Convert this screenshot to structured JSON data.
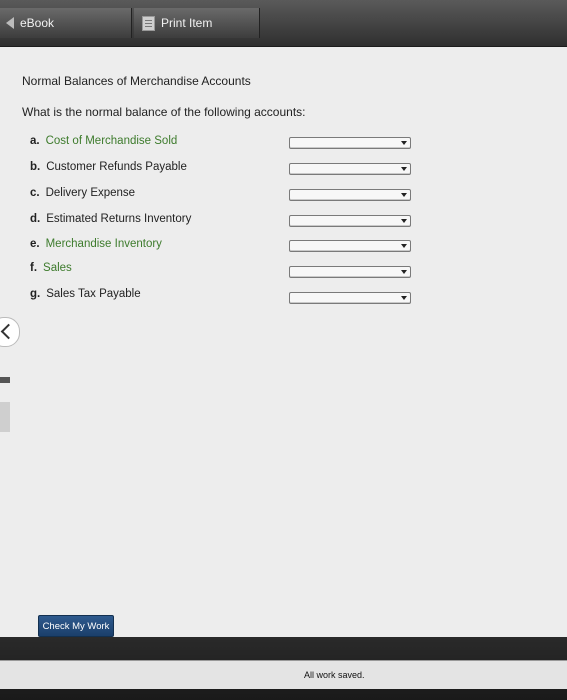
{
  "topbar": {
    "ebook_label": "eBook",
    "print_label": "Print Item"
  },
  "content": {
    "title": "Normal Balances of Merchandise Accounts",
    "question": "What is the normal balance of the following accounts:",
    "items": [
      {
        "letter": "a.",
        "label": "Cost of Merchandise Sold"
      },
      {
        "letter": "b.",
        "label": "Customer Refunds Payable"
      },
      {
        "letter": "c.",
        "label": "Delivery Expense"
      },
      {
        "letter": "d.",
        "label": "Estimated Returns Inventory"
      },
      {
        "letter": "e.",
        "label": "Merchandise Inventory"
      },
      {
        "letter": "f.",
        "label": "Sales"
      },
      {
        "letter": "g.",
        "label": "Sales Tax Payable"
      }
    ]
  },
  "actions": {
    "check_label": "Check My Work"
  },
  "status": {
    "text": "All work saved."
  }
}
